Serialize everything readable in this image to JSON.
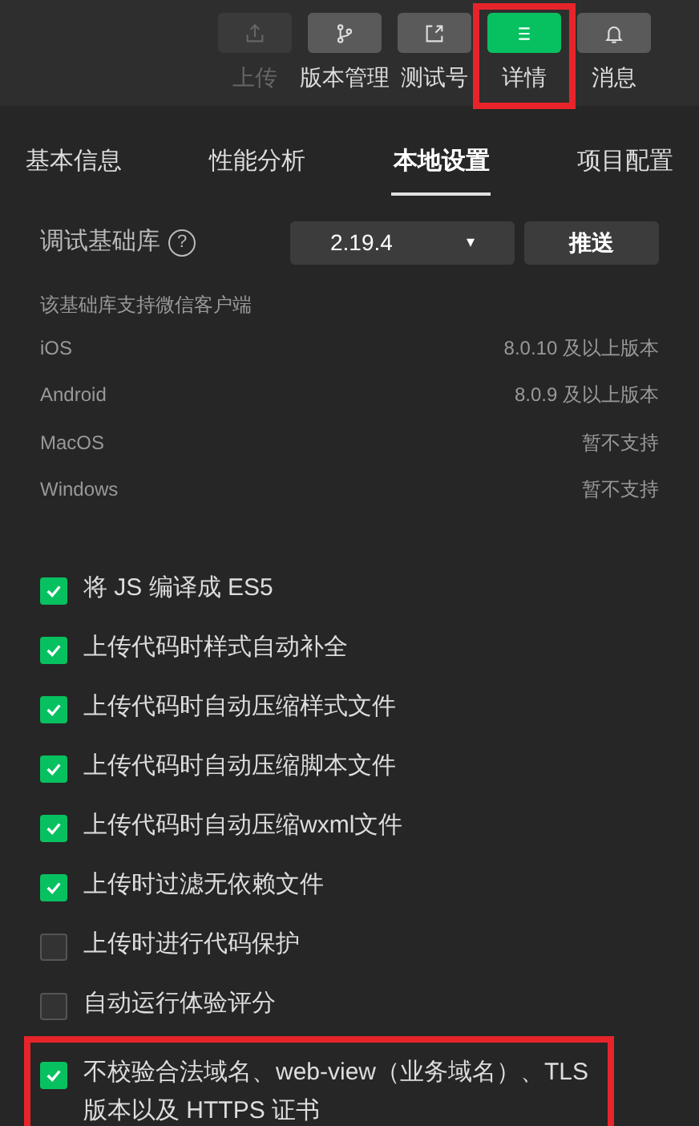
{
  "toolbar": [
    {
      "label": "上传",
      "disabled": true,
      "selected": false,
      "highlighted": false
    },
    {
      "label": "版本管理",
      "disabled": false,
      "selected": false,
      "highlighted": false
    },
    {
      "label": "测试号",
      "disabled": false,
      "selected": false,
      "highlighted": false
    },
    {
      "label": "详情",
      "disabled": false,
      "selected": true,
      "highlighted": true
    },
    {
      "label": "消息",
      "disabled": false,
      "selected": false,
      "highlighted": false
    }
  ],
  "tabs": [
    {
      "label": "基本信息",
      "selected": false
    },
    {
      "label": "性能分析",
      "selected": false
    },
    {
      "label": "本地设置",
      "selected": true
    },
    {
      "label": "项目配置",
      "selected": false
    }
  ],
  "library": {
    "label": "调试基础库",
    "help": "?",
    "version": "2.19.4",
    "caret": "▾",
    "push_button": "推送"
  },
  "support": {
    "title": "该基础库支持微信客户端",
    "rows": [
      {
        "platform": "iOS",
        "value": "8.0.10 及以上版本"
      },
      {
        "platform": "Android",
        "value": "8.0.9 及以上版本"
      },
      {
        "platform": "MacOS",
        "value": "暂不支持"
      },
      {
        "platform": "Windows",
        "value": "暂不支持"
      }
    ]
  },
  "options": [
    {
      "label": "将 JS 编译成 ES5",
      "checked": true,
      "highlighted": false
    },
    {
      "label": "上传代码时样式自动补全",
      "checked": true,
      "highlighted": false
    },
    {
      "label": "上传代码时自动压缩样式文件",
      "checked": true,
      "highlighted": false
    },
    {
      "label": "上传代码时自动压缩脚本文件",
      "checked": true,
      "highlighted": false
    },
    {
      "label": "上传代码时自动压缩wxml文件",
      "checked": true,
      "highlighted": false
    },
    {
      "label": "上传时过滤无依赖文件",
      "checked": true,
      "highlighted": false
    },
    {
      "label": "上传时进行代码保护",
      "checked": false,
      "highlighted": false
    },
    {
      "label": "自动运行体验评分",
      "checked": false,
      "highlighted": false
    },
    {
      "label": "不校验合法域名、web-view（业务域名）、TLS 版本以及 HTTPS 证书",
      "checked": true,
      "highlighted": true
    }
  ]
}
